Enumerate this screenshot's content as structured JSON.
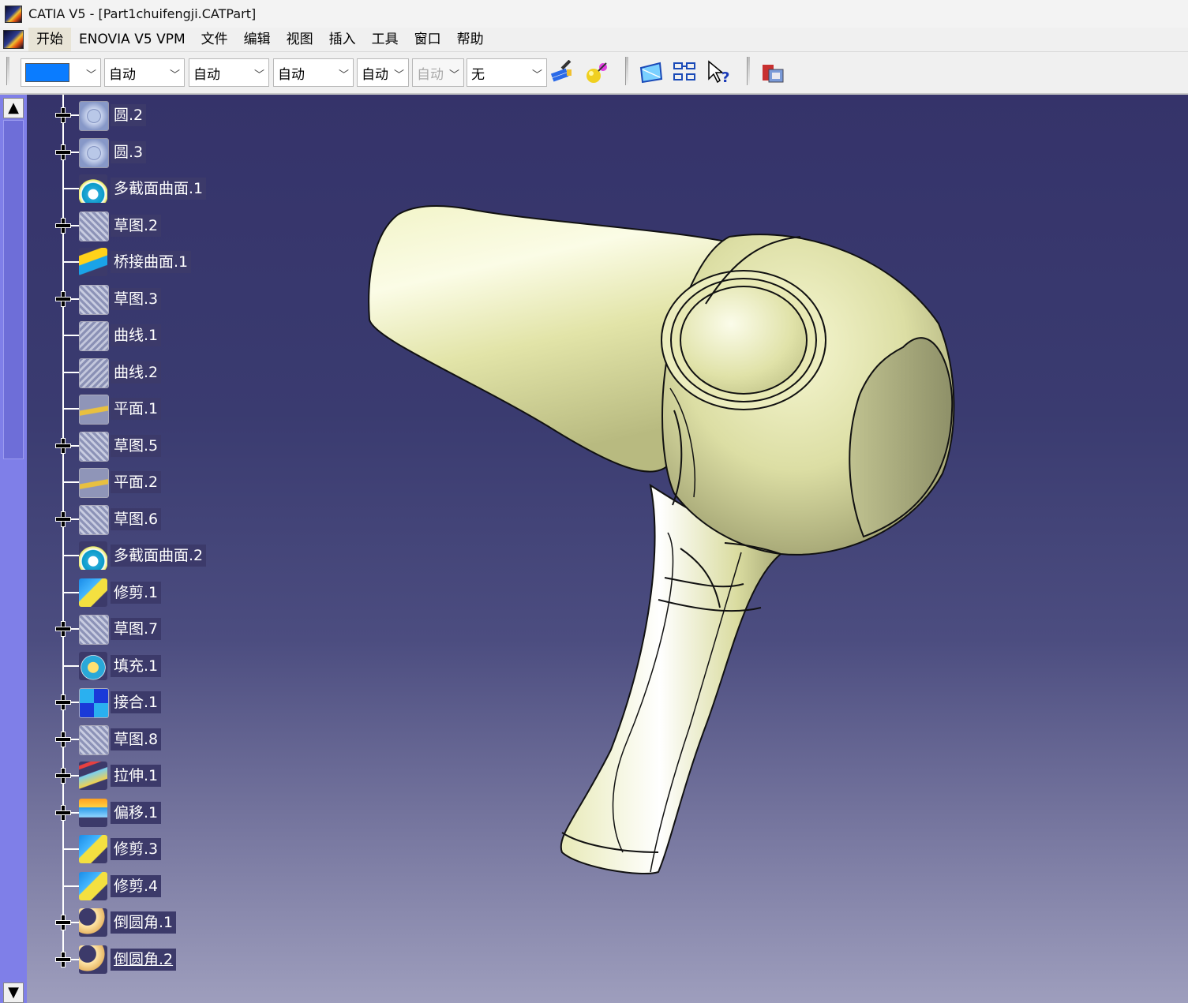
{
  "window": {
    "title": "CATIA V5 - [Part1chuifengji.CATPart]"
  },
  "menu": {
    "items": [
      "开始",
      "ENOVIA V5 VPM",
      "文件",
      "编辑",
      "视图",
      "插入",
      "工具",
      "窗口",
      "帮助"
    ]
  },
  "toolbar": {
    "color_value": "#0a7cff",
    "combo_values": [
      "自动",
      "自动",
      "自动",
      "自动",
      "自动",
      "无"
    ]
  },
  "tree": {
    "items": [
      {
        "label": "圆.2",
        "icon": "circle-icon",
        "expandable": true
      },
      {
        "label": "圆.3",
        "icon": "circle-icon",
        "expandable": true
      },
      {
        "label": "多截面曲面.1",
        "icon": "multi-section-surface-icon",
        "expandable": false
      },
      {
        "label": "草图.2",
        "icon": "sketch-icon",
        "expandable": true
      },
      {
        "label": "桥接曲面.1",
        "icon": "blend-surface-icon",
        "expandable": false
      },
      {
        "label": "草图.3",
        "icon": "sketch-icon",
        "expandable": true
      },
      {
        "label": "曲线.1",
        "icon": "curve-icon",
        "expandable": false
      },
      {
        "label": "曲线.2",
        "icon": "curve-icon",
        "expandable": false
      },
      {
        "label": "平面.1",
        "icon": "plane-icon",
        "expandable": false
      },
      {
        "label": "草图.5",
        "icon": "sketch-icon",
        "expandable": true
      },
      {
        "label": "平面.2",
        "icon": "plane-icon",
        "expandable": false
      },
      {
        "label": "草图.6",
        "icon": "sketch-icon",
        "expandable": true
      },
      {
        "label": "多截面曲面.2",
        "icon": "multi-section-surface-icon",
        "expandable": false
      },
      {
        "label": "修剪.1",
        "icon": "trim-icon",
        "expandable": false
      },
      {
        "label": "草图.7",
        "icon": "sketch-icon",
        "expandable": true
      },
      {
        "label": "填充.1",
        "icon": "fill-icon",
        "expandable": false
      },
      {
        "label": "接合.1",
        "icon": "join-icon",
        "expandable": true
      },
      {
        "label": "草图.8",
        "icon": "sketch-icon",
        "expandable": true
      },
      {
        "label": "拉伸.1",
        "icon": "extrude-icon",
        "expandable": true
      },
      {
        "label": "偏移.1",
        "icon": "offset-icon",
        "expandable": true
      },
      {
        "label": "修剪.3",
        "icon": "trim-icon",
        "expandable": false
      },
      {
        "label": "修剪.4",
        "icon": "trim-icon",
        "expandable": false
      },
      {
        "label": "倒圆角.1",
        "icon": "fillet-icon",
        "expandable": true
      },
      {
        "label": "倒圆角.2",
        "icon": "fillet-icon",
        "expandable": true
      }
    ]
  },
  "model": {
    "surface_color": "#e6e8b0",
    "edge_color": "#111111"
  }
}
